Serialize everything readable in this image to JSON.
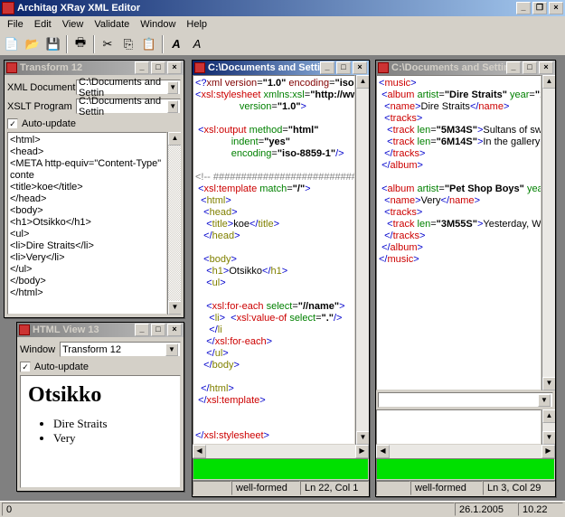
{
  "app": {
    "title": "Architag XRay XML Editor",
    "menus": [
      "File",
      "Edit",
      "View",
      "Validate",
      "Window",
      "Help"
    ]
  },
  "statusbar": {
    "left": "0",
    "date": "26.1.2005",
    "time": "10.22"
  },
  "transform": {
    "title": "Transform 12",
    "xmlLabel": "XML Document",
    "xmlValue": "C:\\Documents and Settin",
    "xslLabel": "XSLT Program",
    "xslValue": "C:\\Documents and Settin",
    "autoUpdate": "Auto-update",
    "lines": [
      "<html>",
      "<head>",
      "<META http-equiv=\"Content-Type\" conte",
      "<title>koe</title>",
      "</head>",
      "<body>",
      "<h1>Otsikko</h1>",
      "<ul>",
      "<li>Dire Straits</li>",
      "<li>Very</li>",
      "</ul>",
      "</body>",
      "</html>"
    ]
  },
  "htmlview": {
    "title": "HTML View 13",
    "windowLabel": "Window",
    "windowValue": "Transform 12",
    "autoUpdate": "Auto-update",
    "heading": "Otsikko",
    "items": [
      "Dire Straits",
      "Very"
    ]
  },
  "editor1": {
    "title": "C:\\Documents and Settings\\O...",
    "status1": "well-formed",
    "status2": "Ln 22, Col 1"
  },
  "editor2": {
    "title": "C:\\Documents and Settings\\O...",
    "status1": "well-formed",
    "status2": "Ln 3, Col 29"
  }
}
